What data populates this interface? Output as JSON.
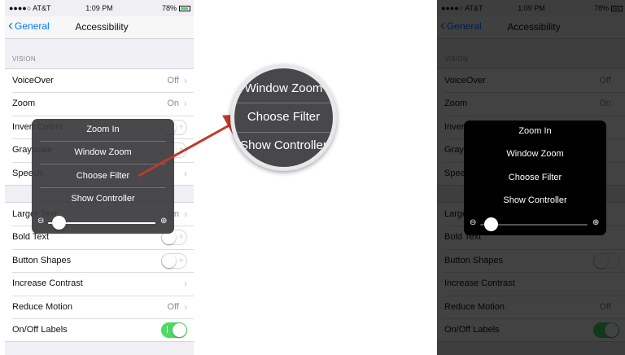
{
  "status": {
    "carrier": "●●●●○ AT&T",
    "time": "1:09 PM",
    "battery": "78%"
  },
  "nav": {
    "back": "General",
    "title": "Accessibility"
  },
  "section": {
    "vision": "VISION"
  },
  "rows": [
    {
      "label": "VoiceOver",
      "value": "Off"
    },
    {
      "label": "Zoom",
      "value": "On"
    },
    {
      "label": "Invert Colors"
    },
    {
      "label": "Grayscale"
    },
    {
      "label": "Speech"
    },
    {
      "label": "Larger Text",
      "value": "On"
    },
    {
      "label": "Bold Text"
    },
    {
      "label": "Button Shapes"
    },
    {
      "label": "Increase Contrast"
    },
    {
      "label": "Reduce Motion",
      "value": "Off"
    },
    {
      "label": "On/Off Labels"
    }
  ],
  "zoom_menu": {
    "options": [
      "Zoom In",
      "Window Zoom",
      "Choose Filter",
      "Show Controller"
    ],
    "slider_level": 0.05
  },
  "magnifier": {
    "options": [
      "Window Zoom",
      "Choose Filter",
      "Show Controller"
    ]
  },
  "colors": {
    "accent": "#007aff",
    "toggle_on": "#4cd964",
    "arrow": "#c0392b"
  }
}
